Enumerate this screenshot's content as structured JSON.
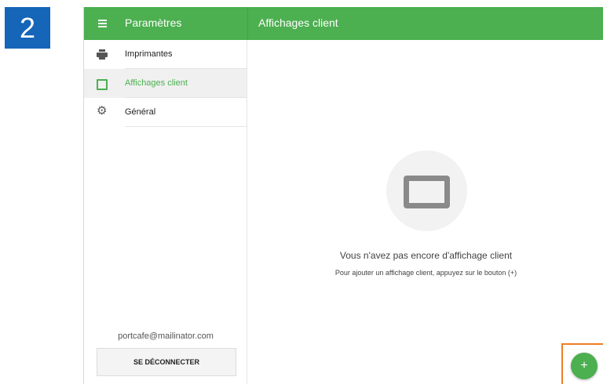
{
  "step": "2",
  "app": {
    "nav_title": "Paramètres",
    "page_title": "Affichages client"
  },
  "sidebar": {
    "items": [
      {
        "label": "Imprimantes",
        "icon": "printer-icon"
      },
      {
        "label": "Affichages client",
        "icon": "display-icon",
        "active": true
      },
      {
        "label": "Général",
        "icon": "gear-icon"
      }
    ],
    "email": "portcafe@mailinator.com",
    "logout_label": "SE DÉCONNECTER"
  },
  "main": {
    "empty_title": "Vous n'avez pas encore d'affichage client",
    "empty_hint": "Pour ajouter un affichage client, appuyez sur le bouton (+)"
  },
  "fab": {
    "label": "+"
  },
  "colors": {
    "accent": "#4caf50",
    "step_badge": "#1565b8",
    "highlight": "#ef7d22"
  }
}
